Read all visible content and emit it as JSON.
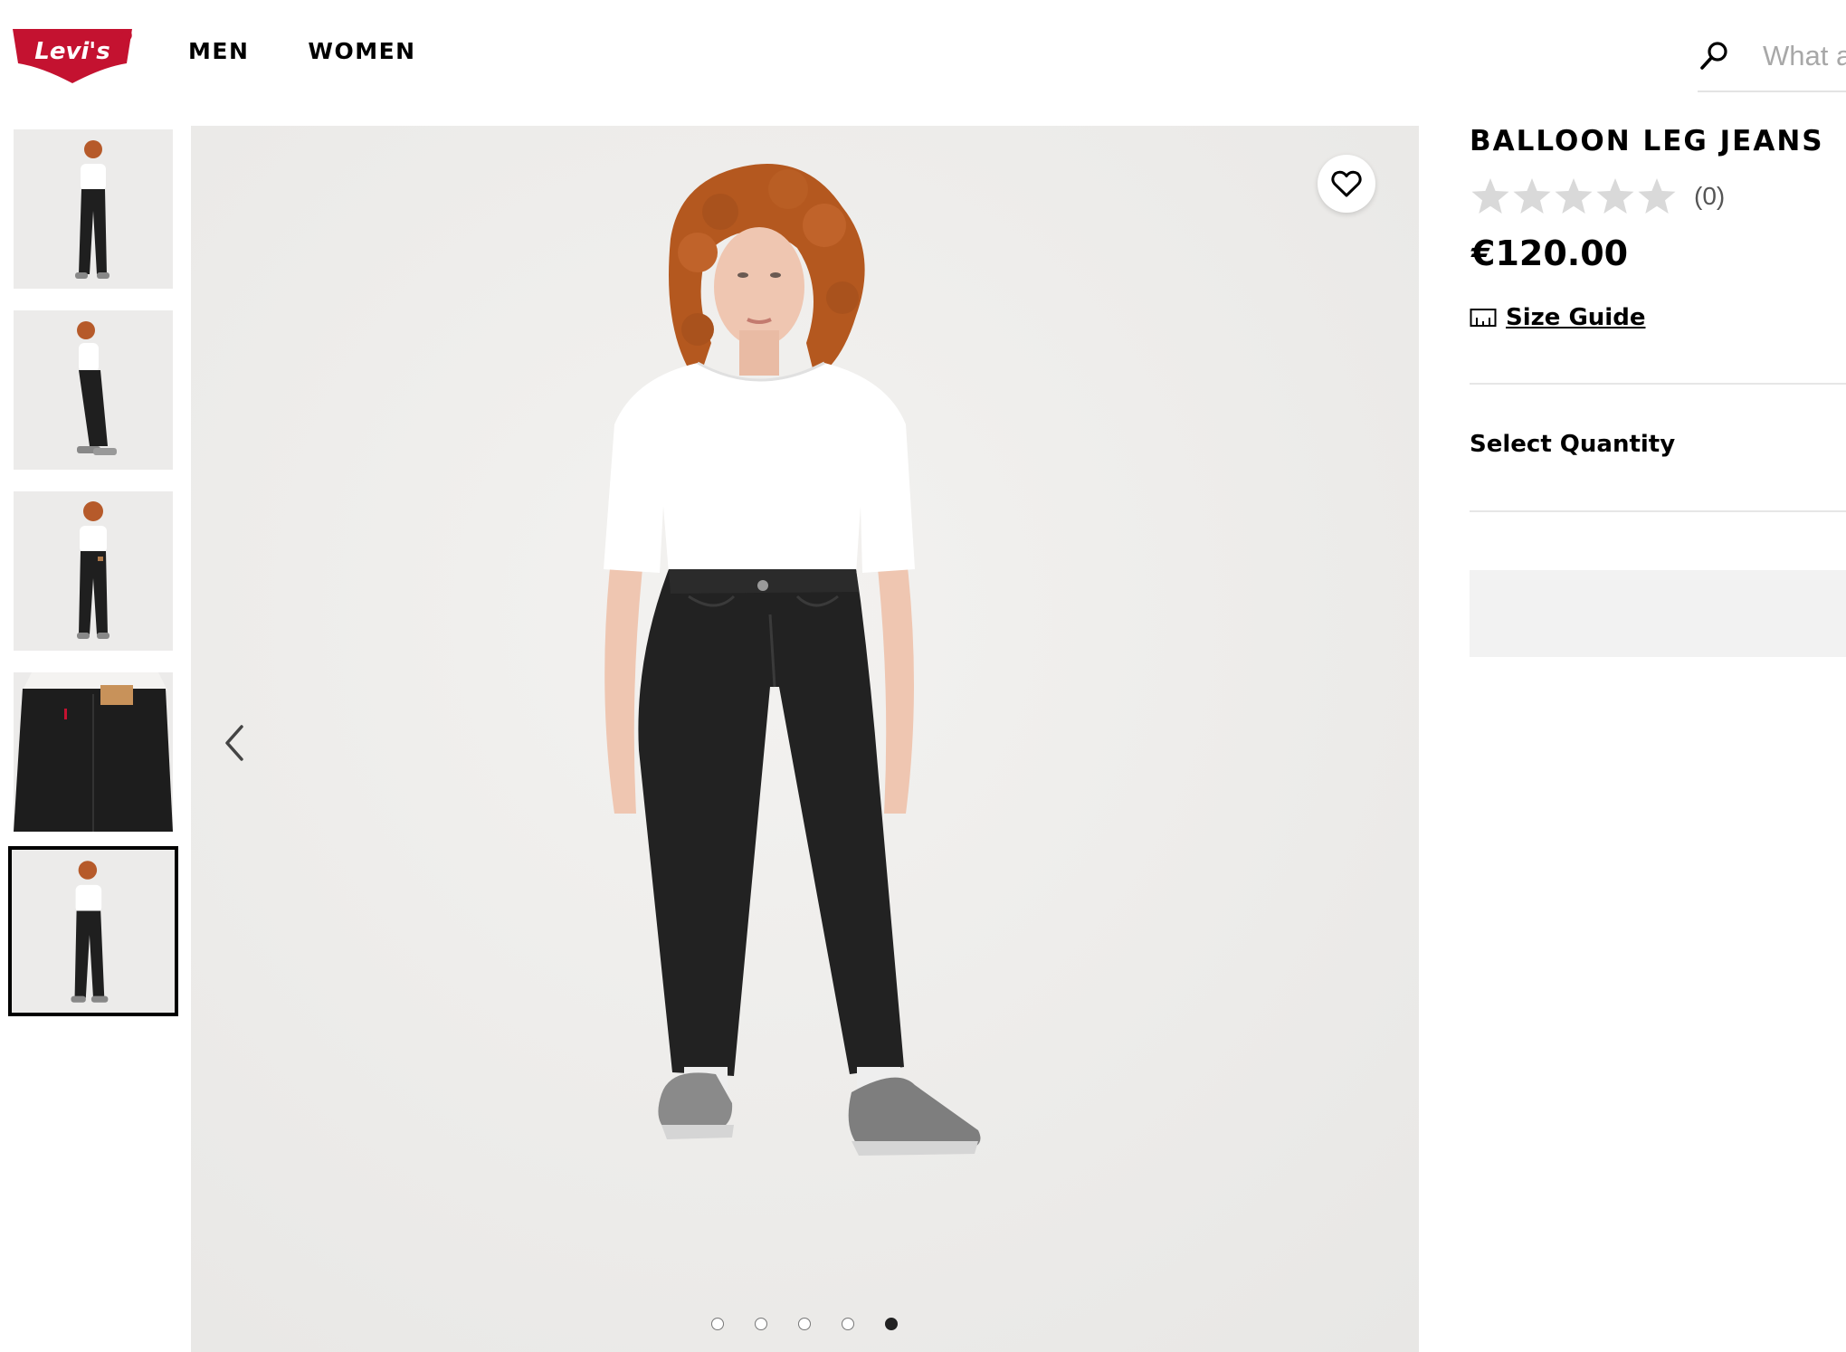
{
  "header": {
    "logo_text": "Levi's",
    "logo_mark": "®",
    "nav": [
      {
        "label": "MEN"
      },
      {
        "label": "WOMEN"
      }
    ],
    "search": {
      "placeholder": "What are you looking for?",
      "icon": "search-icon"
    }
  },
  "gallery": {
    "thumbnail_count": 5,
    "active_index": 4,
    "dots": 5,
    "active_dot": 4,
    "icons": {
      "favorite": "heart-icon",
      "previous": "chevron-left-icon"
    }
  },
  "product": {
    "title": "BALLOON LEG JEANS",
    "rating": {
      "stars": 0,
      "max": 5,
      "count": "(0)"
    },
    "price": "€120.00",
    "size_guide": "Size Guide",
    "select_quantity": "Select Quantity"
  },
  "colors": {
    "brand_red": "#c41230",
    "image_bg": "#edecea",
    "star_empty": "#d9d9d9",
    "button_disabled": "#f2f2f2"
  }
}
